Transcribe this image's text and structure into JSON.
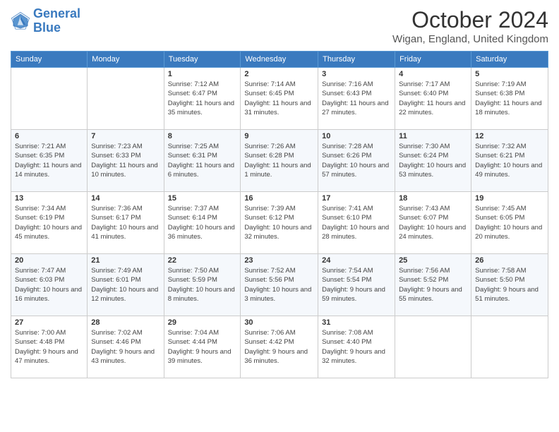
{
  "header": {
    "logo_line1": "General",
    "logo_line2": "Blue",
    "month_title": "October 2024",
    "location": "Wigan, England, United Kingdom"
  },
  "days_of_week": [
    "Sunday",
    "Monday",
    "Tuesday",
    "Wednesday",
    "Thursday",
    "Friday",
    "Saturday"
  ],
  "weeks": [
    [
      {
        "day": "",
        "sunrise": "",
        "sunset": "",
        "daylight": ""
      },
      {
        "day": "",
        "sunrise": "",
        "sunset": "",
        "daylight": ""
      },
      {
        "day": "1",
        "sunrise": "Sunrise: 7:12 AM",
        "sunset": "Sunset: 6:47 PM",
        "daylight": "Daylight: 11 hours and 35 minutes."
      },
      {
        "day": "2",
        "sunrise": "Sunrise: 7:14 AM",
        "sunset": "Sunset: 6:45 PM",
        "daylight": "Daylight: 11 hours and 31 minutes."
      },
      {
        "day": "3",
        "sunrise": "Sunrise: 7:16 AM",
        "sunset": "Sunset: 6:43 PM",
        "daylight": "Daylight: 11 hours and 27 minutes."
      },
      {
        "day": "4",
        "sunrise": "Sunrise: 7:17 AM",
        "sunset": "Sunset: 6:40 PM",
        "daylight": "Daylight: 11 hours and 22 minutes."
      },
      {
        "day": "5",
        "sunrise": "Sunrise: 7:19 AM",
        "sunset": "Sunset: 6:38 PM",
        "daylight": "Daylight: 11 hours and 18 minutes."
      }
    ],
    [
      {
        "day": "6",
        "sunrise": "Sunrise: 7:21 AM",
        "sunset": "Sunset: 6:35 PM",
        "daylight": "Daylight: 11 hours and 14 minutes."
      },
      {
        "day": "7",
        "sunrise": "Sunrise: 7:23 AM",
        "sunset": "Sunset: 6:33 PM",
        "daylight": "Daylight: 11 hours and 10 minutes."
      },
      {
        "day": "8",
        "sunrise": "Sunrise: 7:25 AM",
        "sunset": "Sunset: 6:31 PM",
        "daylight": "Daylight: 11 hours and 6 minutes."
      },
      {
        "day": "9",
        "sunrise": "Sunrise: 7:26 AM",
        "sunset": "Sunset: 6:28 PM",
        "daylight": "Daylight: 11 hours and 1 minute."
      },
      {
        "day": "10",
        "sunrise": "Sunrise: 7:28 AM",
        "sunset": "Sunset: 6:26 PM",
        "daylight": "Daylight: 10 hours and 57 minutes."
      },
      {
        "day": "11",
        "sunrise": "Sunrise: 7:30 AM",
        "sunset": "Sunset: 6:24 PM",
        "daylight": "Daylight: 10 hours and 53 minutes."
      },
      {
        "day": "12",
        "sunrise": "Sunrise: 7:32 AM",
        "sunset": "Sunset: 6:21 PM",
        "daylight": "Daylight: 10 hours and 49 minutes."
      }
    ],
    [
      {
        "day": "13",
        "sunrise": "Sunrise: 7:34 AM",
        "sunset": "Sunset: 6:19 PM",
        "daylight": "Daylight: 10 hours and 45 minutes."
      },
      {
        "day": "14",
        "sunrise": "Sunrise: 7:36 AM",
        "sunset": "Sunset: 6:17 PM",
        "daylight": "Daylight: 10 hours and 41 minutes."
      },
      {
        "day": "15",
        "sunrise": "Sunrise: 7:37 AM",
        "sunset": "Sunset: 6:14 PM",
        "daylight": "Daylight: 10 hours and 36 minutes."
      },
      {
        "day": "16",
        "sunrise": "Sunrise: 7:39 AM",
        "sunset": "Sunset: 6:12 PM",
        "daylight": "Daylight: 10 hours and 32 minutes."
      },
      {
        "day": "17",
        "sunrise": "Sunrise: 7:41 AM",
        "sunset": "Sunset: 6:10 PM",
        "daylight": "Daylight: 10 hours and 28 minutes."
      },
      {
        "day": "18",
        "sunrise": "Sunrise: 7:43 AM",
        "sunset": "Sunset: 6:07 PM",
        "daylight": "Daylight: 10 hours and 24 minutes."
      },
      {
        "day": "19",
        "sunrise": "Sunrise: 7:45 AM",
        "sunset": "Sunset: 6:05 PM",
        "daylight": "Daylight: 10 hours and 20 minutes."
      }
    ],
    [
      {
        "day": "20",
        "sunrise": "Sunrise: 7:47 AM",
        "sunset": "Sunset: 6:03 PM",
        "daylight": "Daylight: 10 hours and 16 minutes."
      },
      {
        "day": "21",
        "sunrise": "Sunrise: 7:49 AM",
        "sunset": "Sunset: 6:01 PM",
        "daylight": "Daylight: 10 hours and 12 minutes."
      },
      {
        "day": "22",
        "sunrise": "Sunrise: 7:50 AM",
        "sunset": "Sunset: 5:59 PM",
        "daylight": "Daylight: 10 hours and 8 minutes."
      },
      {
        "day": "23",
        "sunrise": "Sunrise: 7:52 AM",
        "sunset": "Sunset: 5:56 PM",
        "daylight": "Daylight: 10 hours and 3 minutes."
      },
      {
        "day": "24",
        "sunrise": "Sunrise: 7:54 AM",
        "sunset": "Sunset: 5:54 PM",
        "daylight": "Daylight: 9 hours and 59 minutes."
      },
      {
        "day": "25",
        "sunrise": "Sunrise: 7:56 AM",
        "sunset": "Sunset: 5:52 PM",
        "daylight": "Daylight: 9 hours and 55 minutes."
      },
      {
        "day": "26",
        "sunrise": "Sunrise: 7:58 AM",
        "sunset": "Sunset: 5:50 PM",
        "daylight": "Daylight: 9 hours and 51 minutes."
      }
    ],
    [
      {
        "day": "27",
        "sunrise": "Sunrise: 7:00 AM",
        "sunset": "Sunset: 4:48 PM",
        "daylight": "Daylight: 9 hours and 47 minutes."
      },
      {
        "day": "28",
        "sunrise": "Sunrise: 7:02 AM",
        "sunset": "Sunset: 4:46 PM",
        "daylight": "Daylight: 9 hours and 43 minutes."
      },
      {
        "day": "29",
        "sunrise": "Sunrise: 7:04 AM",
        "sunset": "Sunset: 4:44 PM",
        "daylight": "Daylight: 9 hours and 39 minutes."
      },
      {
        "day": "30",
        "sunrise": "Sunrise: 7:06 AM",
        "sunset": "Sunset: 4:42 PM",
        "daylight": "Daylight: 9 hours and 36 minutes."
      },
      {
        "day": "31",
        "sunrise": "Sunrise: 7:08 AM",
        "sunset": "Sunset: 4:40 PM",
        "daylight": "Daylight: 9 hours and 32 minutes."
      },
      {
        "day": "",
        "sunrise": "",
        "sunset": "",
        "daylight": ""
      },
      {
        "day": "",
        "sunrise": "",
        "sunset": "",
        "daylight": ""
      }
    ]
  ]
}
